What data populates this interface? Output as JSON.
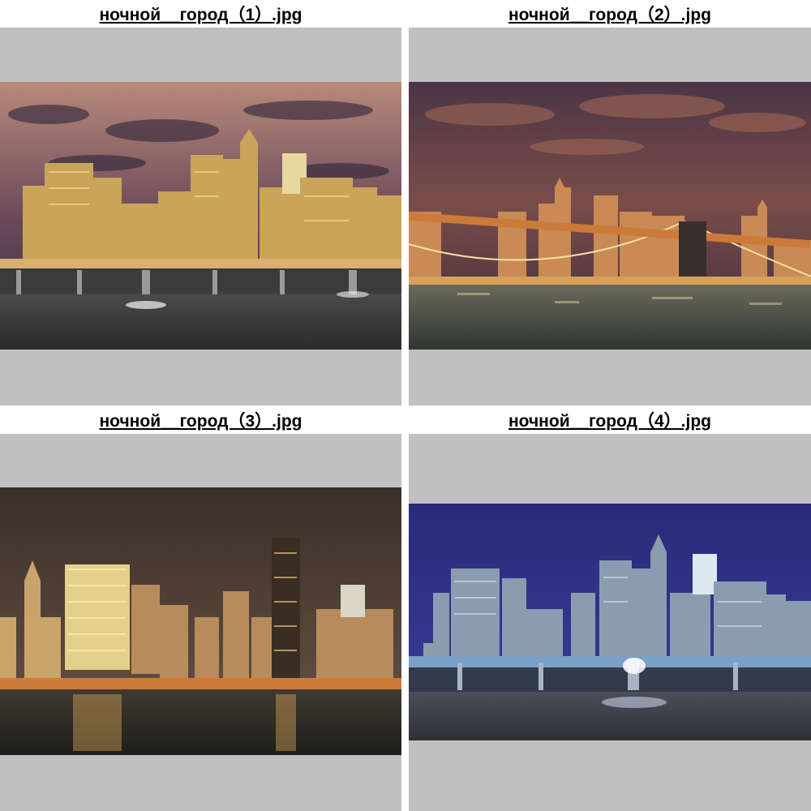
{
  "gallery": {
    "items": [
      {
        "caption": "ночной__город（1）.jpg",
        "scene": "night-city-skyline-pier"
      },
      {
        "caption": "ночной__город（2）.jpg",
        "scene": "night-city-skyline-bridge"
      },
      {
        "caption": "ночной__город（3）.jpg",
        "scene": "night-city-skyline-river"
      },
      {
        "caption": "ночной__город（4）.jpg",
        "scene": "night-city-skyline-blue-pier"
      }
    ]
  },
  "colors": {
    "thumbnail_background": "#c0c0c0",
    "page_background": "#ffffff",
    "caption_text": "#000000"
  }
}
